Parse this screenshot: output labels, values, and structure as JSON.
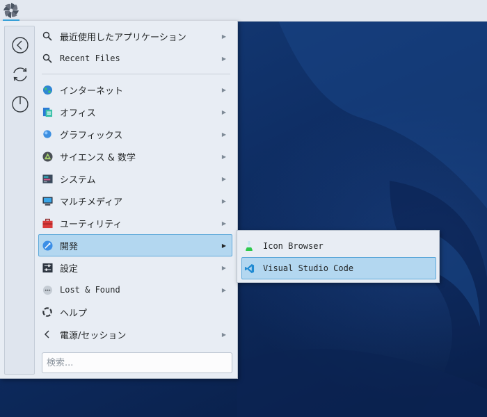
{
  "menu": {
    "sidebar": [
      {
        "name": "back-icon"
      },
      {
        "name": "switch-user-icon"
      },
      {
        "name": "power-icon"
      }
    ],
    "items": [
      {
        "label": "最近使用したアプリケーション",
        "icon": "search-icon",
        "has_submenu": true
      },
      {
        "label": "Recent Files",
        "icon": "search-icon",
        "has_submenu": true
      },
      {
        "label": "インターネット",
        "icon": "internet-globe-icon",
        "has_submenu": true
      },
      {
        "label": "オフィス",
        "icon": "office-icon",
        "has_submenu": true
      },
      {
        "label": "グラフィックス",
        "icon": "graphics-icon",
        "has_submenu": true
      },
      {
        "label": "サイエンス & 数学",
        "icon": "science-icon",
        "has_submenu": true
      },
      {
        "label": "システム",
        "icon": "system-icon",
        "has_submenu": true
      },
      {
        "label": "マルチメディア",
        "icon": "multimedia-icon",
        "has_submenu": true
      },
      {
        "label": "ユーティリティ",
        "icon": "utilities-toolbox-icon",
        "has_submenu": true
      },
      {
        "label": "開発",
        "icon": "development-icon",
        "has_submenu": true,
        "active": true
      },
      {
        "label": "設定",
        "icon": "settings-icon",
        "has_submenu": true
      },
      {
        "label": "Lost & Found",
        "icon": "lost-found-icon",
        "has_submenu": true
      },
      {
        "label": "ヘルプ",
        "icon": "help-lifebuoy-icon",
        "has_submenu": false
      },
      {
        "label": "電源/セッション",
        "icon": "chevron-left-icon",
        "has_submenu": true
      }
    ],
    "search": {
      "placeholder": "検索..."
    }
  },
  "submenu": {
    "items": [
      {
        "label": "Icon Browser",
        "icon": "icon-browser-flask-icon"
      },
      {
        "label": "Visual Studio Code",
        "icon": "vscode-icon",
        "active": true
      }
    ]
  },
  "colors": {
    "highlight": "#b3d7f0",
    "highlight_border": "#5ea9da",
    "accent": "#3daee9",
    "wallpaper": "#0e2a57"
  }
}
